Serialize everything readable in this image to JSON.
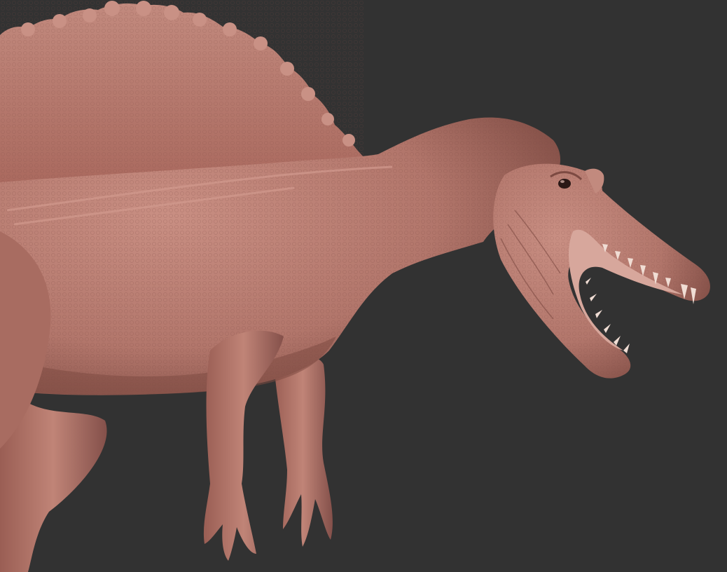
{
  "scene": {
    "subject_icon": "dinosaur-sculpt-icon",
    "colors": {
      "background": "#323232",
      "skin_base": "#b2766b",
      "skin_light": "#c98f83",
      "skin_dark": "#7d4a42",
      "shadow": "#4a2a25",
      "mouth": "#d7a79c",
      "teeth": "#f0ddd4",
      "eye": "#2a1816"
    }
  }
}
